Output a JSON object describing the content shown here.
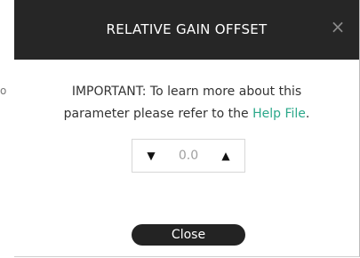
{
  "background": {
    "fragment_text": "o"
  },
  "dialog": {
    "title": "RELATIVE GAIN OFFSET",
    "close_glyph": "×",
    "message": {
      "line1": "IMPORTANT: To learn more about this",
      "line2_prefix": "parameter please refer to the ",
      "link_text": "Help File",
      "line2_suffix": "."
    },
    "stepper": {
      "value": "0.0",
      "decrease_glyph": "▼",
      "increase_glyph": "▲"
    },
    "close_button_label": "Close"
  },
  "colors": {
    "titlebar": "#262626",
    "link": "#2ba88a",
    "button": "#232323",
    "value_text": "#a0a0a0"
  }
}
